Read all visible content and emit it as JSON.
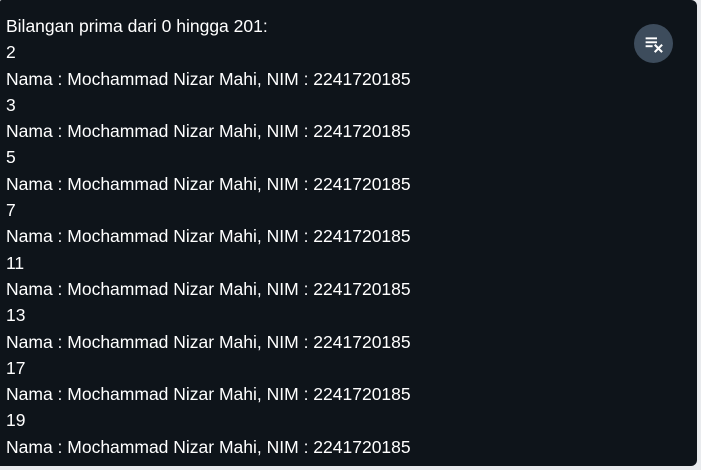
{
  "console": {
    "lines": [
      "Bilangan prima dari 0 hingga 201:",
      "2",
      "Nama : Mochammad Nizar Mahi, NIM : 2241720185",
      "3",
      "Nama : Mochammad Nizar Mahi, NIM : 2241720185",
      "5",
      "Nama : Mochammad Nizar Mahi, NIM : 2241720185",
      "7",
      "Nama : Mochammad Nizar Mahi, NIM : 2241720185",
      "11",
      "Nama : Mochammad Nizar Mahi, NIM : 2241720185",
      "13",
      "Nama : Mochammad Nizar Mahi, NIM : 2241720185",
      "17",
      "Nama : Mochammad Nizar Mahi, NIM : 2241720185",
      "19",
      "Nama : Mochammad Nizar Mahi, NIM : 2241720185"
    ],
    "clear_button_icon": "clear-all-icon"
  },
  "colors": {
    "background": "#0e141a",
    "text": "#ffffff",
    "button": "#3d4c5c"
  }
}
